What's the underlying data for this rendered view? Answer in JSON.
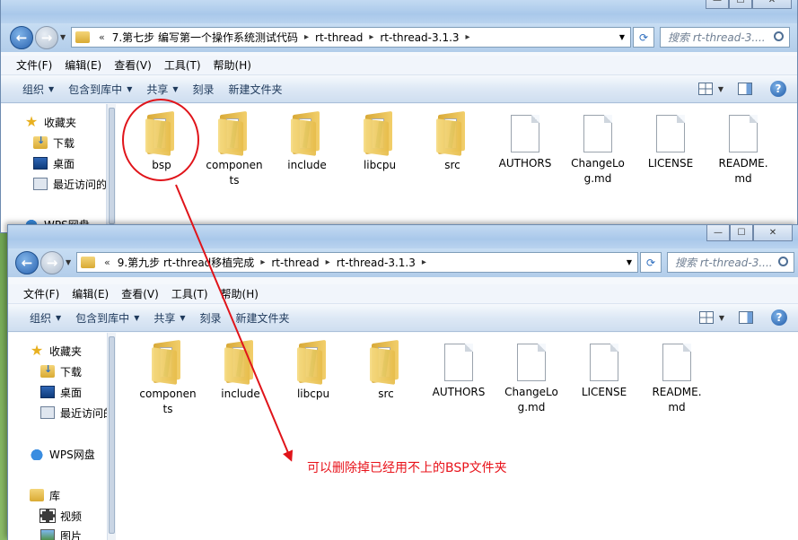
{
  "colors": {
    "accent": "#2a63b0",
    "annotation": "#e0141a",
    "window_frame": "#a9c8ea"
  },
  "window_top": {
    "breadcrumb": [
      "7.第七步 编写第一个操作系统测试代码",
      "rt-thread",
      "rt-thread-3.1.3"
    ],
    "breadcrumb_lead": "«",
    "search_placeholder": "搜索 rt-thread-3....",
    "menus": [
      "文件(F)",
      "编辑(E)",
      "查看(V)",
      "工具(T)",
      "帮助(H)"
    ],
    "commands": {
      "organize": "组织",
      "include_library": "包含到库中",
      "share": "共享",
      "burn": "刻录",
      "new_folder": "新建文件夹"
    },
    "nav": {
      "favorites": "收藏夹",
      "downloads": "下载",
      "desktop": "桌面",
      "recent": "最近访问的",
      "wps": "WPS网盘"
    },
    "items": [
      {
        "name": "bsp",
        "type": "folder"
      },
      {
        "name": "components",
        "type": "folder",
        "label_lines": [
          "componen",
          "ts"
        ]
      },
      {
        "name": "include",
        "type": "folder"
      },
      {
        "name": "libcpu",
        "type": "folder"
      },
      {
        "name": "src",
        "type": "folder"
      },
      {
        "name": "AUTHORS",
        "type": "file"
      },
      {
        "name": "ChangeLog.md",
        "type": "file",
        "label_lines": [
          "ChangeLo",
          "g.md"
        ]
      },
      {
        "name": "LICENSE",
        "type": "file"
      },
      {
        "name": "README.md",
        "type": "file",
        "label_lines": [
          "README.",
          "md"
        ]
      }
    ]
  },
  "window_bottom": {
    "breadcrumb": [
      "9.第九步 rt-thread移植完成",
      "rt-thread",
      "rt-thread-3.1.3"
    ],
    "breadcrumb_lead": "«",
    "search_placeholder": "搜索 rt-thread-3....",
    "menus": [
      "文件(F)",
      "编辑(E)",
      "查看(V)",
      "工具(T)",
      "帮助(H)"
    ],
    "commands": {
      "organize": "组织",
      "include_library": "包含到库中",
      "share": "共享",
      "burn": "刻录",
      "new_folder": "新建文件夹"
    },
    "nav": {
      "favorites": "收藏夹",
      "downloads": "下载",
      "desktop": "桌面",
      "recent": "最近访问的",
      "wps": "WPS网盘",
      "library": "库",
      "video": "视频",
      "pictures": "图片"
    },
    "items": [
      {
        "name": "components",
        "type": "folder",
        "label_lines": [
          "componen",
          "ts"
        ]
      },
      {
        "name": "include",
        "type": "folder"
      },
      {
        "name": "libcpu",
        "type": "folder"
      },
      {
        "name": "src",
        "type": "folder"
      },
      {
        "name": "AUTHORS",
        "type": "file"
      },
      {
        "name": "ChangeLog.md",
        "type": "file",
        "label_lines": [
          "ChangeLo",
          "g.md"
        ]
      },
      {
        "name": "LICENSE",
        "type": "file"
      },
      {
        "name": "README.md",
        "type": "file",
        "label_lines": [
          "README.",
          "md"
        ]
      }
    ]
  },
  "annotation": {
    "text": "可以删除掉已经用不上的BSP文件夹"
  }
}
